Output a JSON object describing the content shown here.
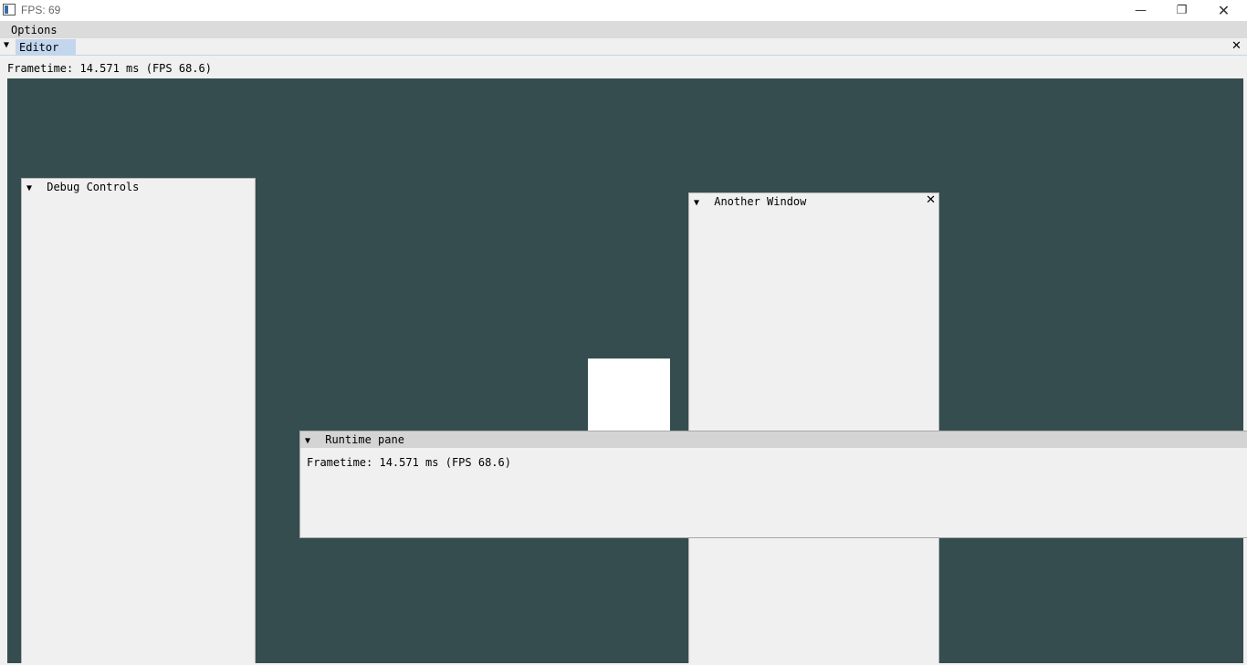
{
  "os_window": {
    "title": "FPS: 69",
    "minimize_glyph": "—",
    "maximize_glyph": "❐",
    "close_glyph": "✕"
  },
  "menu": {
    "items": [
      {
        "label": "Options"
      }
    ]
  },
  "editor_tab": {
    "arrow": "▼",
    "label": "Editor",
    "close_glyph": "✕"
  },
  "stats": {
    "frametime_text": "Frametime: 14.571 ms (FPS 68.6)"
  },
  "colors": {
    "viewport_bg": "#354d4e",
    "tab_active": "#c2d6ee",
    "panel_bg": "#f0f0f0"
  },
  "windows": {
    "debug_controls": {
      "arrow": "▼",
      "title": "Debug Controls"
    },
    "another_window": {
      "arrow": "▼",
      "title": "Another Window",
      "close_glyph": "✕"
    },
    "runtime_pane": {
      "arrow": "▼",
      "title": "Runtime pane",
      "frametime_text": "Frametime: 14.571 ms (FPS 68.6)"
    }
  }
}
